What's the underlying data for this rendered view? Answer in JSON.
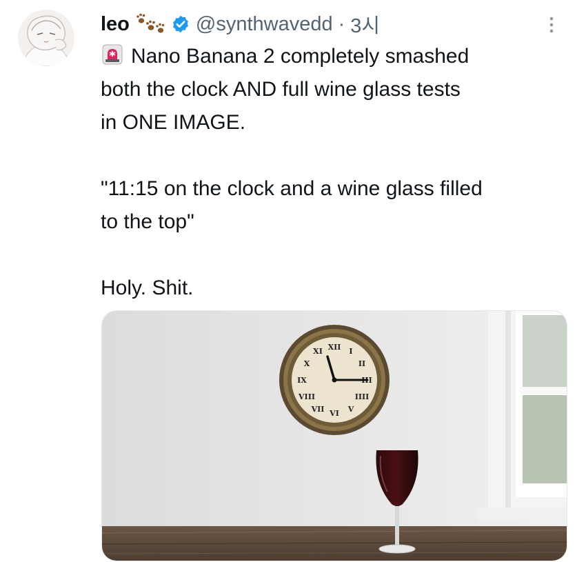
{
  "author": {
    "display_name": "leo",
    "name_emoji": "paw-prints-icon",
    "verified": true,
    "handle": "@synthwavedd",
    "separator": "·",
    "timestamp": "3시",
    "avatar": "anime-avatar"
  },
  "tweet": {
    "lines": [
      "Nano Banana 2 completely smashed",
      "both the clock AND full wine glass tests",
      "in ONE IMAGE.",
      "",
      "\"11:15 on the clock and a wine glass filled",
      "to the top\"",
      "",
      "Holy. Shit."
    ],
    "leading_emoji": "siren-icon"
  },
  "media": {
    "description_icons": [
      "wall-clock",
      "wine-glass",
      "window",
      "wooden-table"
    ],
    "clock_numerals": [
      "XII",
      "I",
      "II",
      "III",
      "IIII",
      "V",
      "VI",
      "VII",
      "VIII",
      "IX",
      "X",
      "XI"
    ]
  },
  "colors": {
    "text": "#0f1419",
    "secondary": "#536471",
    "verified": "#1d9bf0",
    "siren": "#e0245e"
  }
}
